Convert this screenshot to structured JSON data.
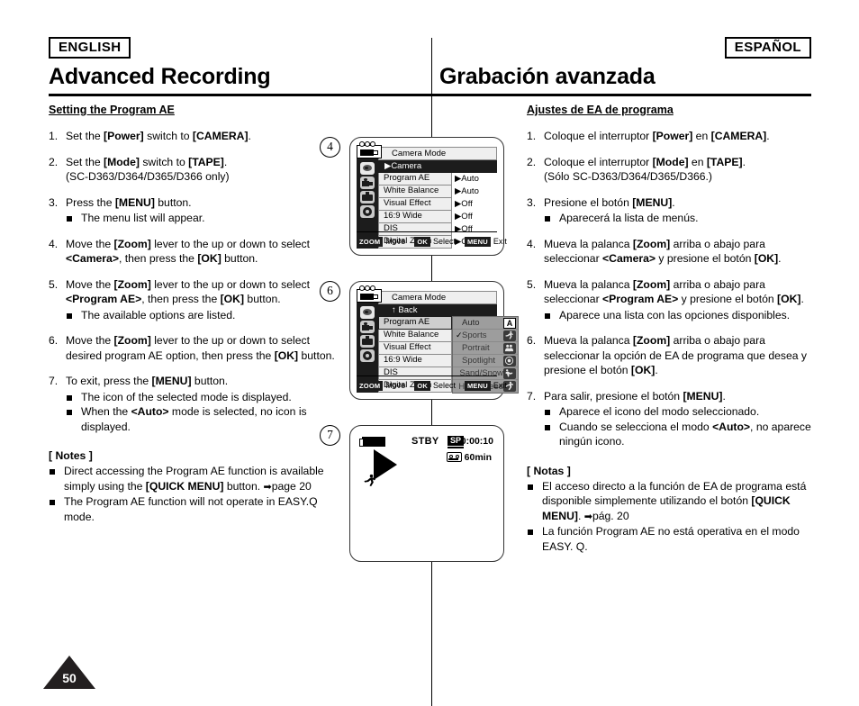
{
  "page": {
    "number": "50",
    "lang_badge_left": "ENGLISH",
    "lang_badge_right": "ESPAÑOL",
    "title_left": "Advanced Recording",
    "title_right": "Grabación avanzada"
  },
  "english": {
    "section_heading": "Setting the Program AE",
    "steps": [
      {
        "num": "1.",
        "text_html": "Set the <b>[Power]</b> switch to <b>[CAMERA]</b>.",
        "subs": []
      },
      {
        "num": "2.",
        "text_html": "Set the <b>[Mode]</b> switch to <b>[TAPE]</b>.<br>(SC-D363/D364/D365/D366 only)",
        "subs": []
      },
      {
        "num": "3.",
        "text_html": "Press the <b>[MENU]</b> button.",
        "subs": [
          "The menu list will appear."
        ]
      },
      {
        "num": "4.",
        "text_html": "Move the <b>[Zoom]</b> lever to the up or down to select <b>&lt;Camera&gt;</b>, then press the <b>[OK]</b> button.",
        "subs": []
      },
      {
        "num": "5.",
        "text_html": "Move the <b>[Zoom]</b> lever to the up or down to select <b>&lt;Program AE&gt;</b>, then press the <b>[OK]</b> button.",
        "subs": [
          "The available options are listed."
        ]
      },
      {
        "num": "6.",
        "text_html": "Move the <b>[Zoom]</b> lever to the up or down to select desired program AE option, then press the <b>[OK]</b> button.",
        "subs": []
      },
      {
        "num": "7.",
        "text_html": "To exit, press the <b>[MENU]</b> button.",
        "subs": [
          "The icon of the selected mode is displayed.",
          "When the <b>&lt;Auto&gt;</b> mode is selected, no icon is displayed."
        ]
      }
    ],
    "notes_title": "[ Notes ]",
    "notes": [
      "Direct accessing the Program AE function is available simply using the <b>[QUICK MENU]</b> button. <span class=\"arrow-r\">➡</span>page 20",
      "The Program AE function will not operate in EASY.Q mode."
    ]
  },
  "spanish": {
    "section_heading": "Ajustes de EA de programa",
    "steps": [
      {
        "num": "1.",
        "text_html": "Coloque el interruptor <b>[Power]</b> en <b>[CAMERA]</b>.",
        "subs": []
      },
      {
        "num": "2.",
        "text_html": "Coloque el interruptor <b>[Mode]</b> en <b>[TAPE]</b>.<br>(Sólo SC-D363/D364/D365/D366.)",
        "subs": []
      },
      {
        "num": "3.",
        "text_html": "Presione el botón <b>[MENU]</b>.",
        "subs": [
          "Aparecerá la lista de menús."
        ]
      },
      {
        "num": "4.",
        "text_html": "Mueva la palanca <b>[Zoom]</b> arriba o abajo para seleccionar <b>&lt;Camera&gt;</b> y presione el botón <b>[OK]</b>.",
        "subs": []
      },
      {
        "num": "5.",
        "text_html": "Mueva la palanca <b>[Zoom]</b> arriba o abajo para seleccionar <b>&lt;Program AE&gt;</b> y presione el botón <b>[OK]</b>.",
        "subs": [
          "Aparece una lista con las opciones disponibles."
        ]
      },
      {
        "num": "6.",
        "text_html": "Mueva la palanca <b>[Zoom]</b> arriba o abajo para seleccionar la opción de EA de programa que desea y presione el botón <b>[OK]</b>.",
        "subs": []
      },
      {
        "num": "7.",
        "text_html": "Para salir, presione el botón <b>[MENU]</b>.",
        "subs": [
          "Aparece el icono del modo seleccionado.",
          "Cuando se selecciona el modo <b>&lt;Auto&gt;</b>, no aparece ningún icono."
        ]
      }
    ],
    "notes_title": "[ Notas ]",
    "notes": [
      "El acceso directo a la función de EA de programa está disponible simplemente utilizando el botón <b>[QUICK MENU]</b>. <span class=\"arrow-r\">➡</span>pág. 20",
      "La función Program AE no está operativa en el modo EASY. Q."
    ]
  },
  "callouts": {
    "four": "4",
    "six": "6",
    "seven": "7"
  },
  "lcd_menu_1": {
    "title": "Camera Mode",
    "selected_row": "Camera",
    "selected_row_marker": "▶",
    "rows": [
      {
        "label": "Program AE",
        "value": "▶Auto"
      },
      {
        "label": "White Balance",
        "value": "▶Auto"
      },
      {
        "label": "Visual Effect",
        "value": "▶Off"
      },
      {
        "label": "16:9 Wide",
        "value": "▶Off"
      },
      {
        "label": "DIS",
        "value": "▶Off"
      },
      {
        "label": "Digital Zoom",
        "value": "▶Off"
      }
    ],
    "side_icons": [
      "lens-icon",
      "camcorder-icon",
      "monitor-icon",
      "gear-icon"
    ],
    "guide": [
      {
        "key": "ZOOM",
        "text": "Move"
      },
      {
        "key": "OK",
        "text": "Select"
      },
      {
        "key": "MENU",
        "text": "Exit"
      }
    ]
  },
  "lcd_menu_2": {
    "title": "Camera Mode",
    "back_row": "Back",
    "back_marker": "↑",
    "rows": [
      {
        "label": "Program AE"
      },
      {
        "label": "White Balance"
      },
      {
        "label": "Visual Effect"
      },
      {
        "label": "16:9 Wide"
      },
      {
        "label": "DIS"
      },
      {
        "label": "Digital Zoom"
      }
    ],
    "options": [
      {
        "name": "Auto",
        "checked": "",
        "icon": "letter-a-icon",
        "icon_char": "A"
      },
      {
        "name": "Sports",
        "checked": "✓",
        "icon": "sports-icon",
        "icon_char": ""
      },
      {
        "name": "Portrait",
        "checked": "",
        "icon": "portrait-icon",
        "icon_char": ""
      },
      {
        "name": "Spotlight",
        "checked": "",
        "icon": "spotlight-icon",
        "icon_char": ""
      },
      {
        "name": "Sand/Snow",
        "checked": "",
        "icon": "sand-snow-icon",
        "icon_char": ""
      },
      {
        "name": "High Speed",
        "checked": "",
        "icon": "high-speed-icon",
        "icon_char": ""
      }
    ],
    "side_icons": [
      "lens-icon",
      "camcorder-icon",
      "monitor-icon",
      "gear-icon"
    ],
    "guide": [
      {
        "key": "ZOOM",
        "text": "Move"
      },
      {
        "key": "OK",
        "text": "Select"
      },
      {
        "key": "MENU",
        "text": "Exit"
      }
    ]
  },
  "lcd_stby": {
    "status": "STBY",
    "record_mode": "SP",
    "timecode": "0:00:10",
    "tape_remaining": "60min",
    "icons": [
      "battery-icon",
      "play-triangle-icon",
      "sports-mode-icon",
      "tape-icon"
    ]
  }
}
